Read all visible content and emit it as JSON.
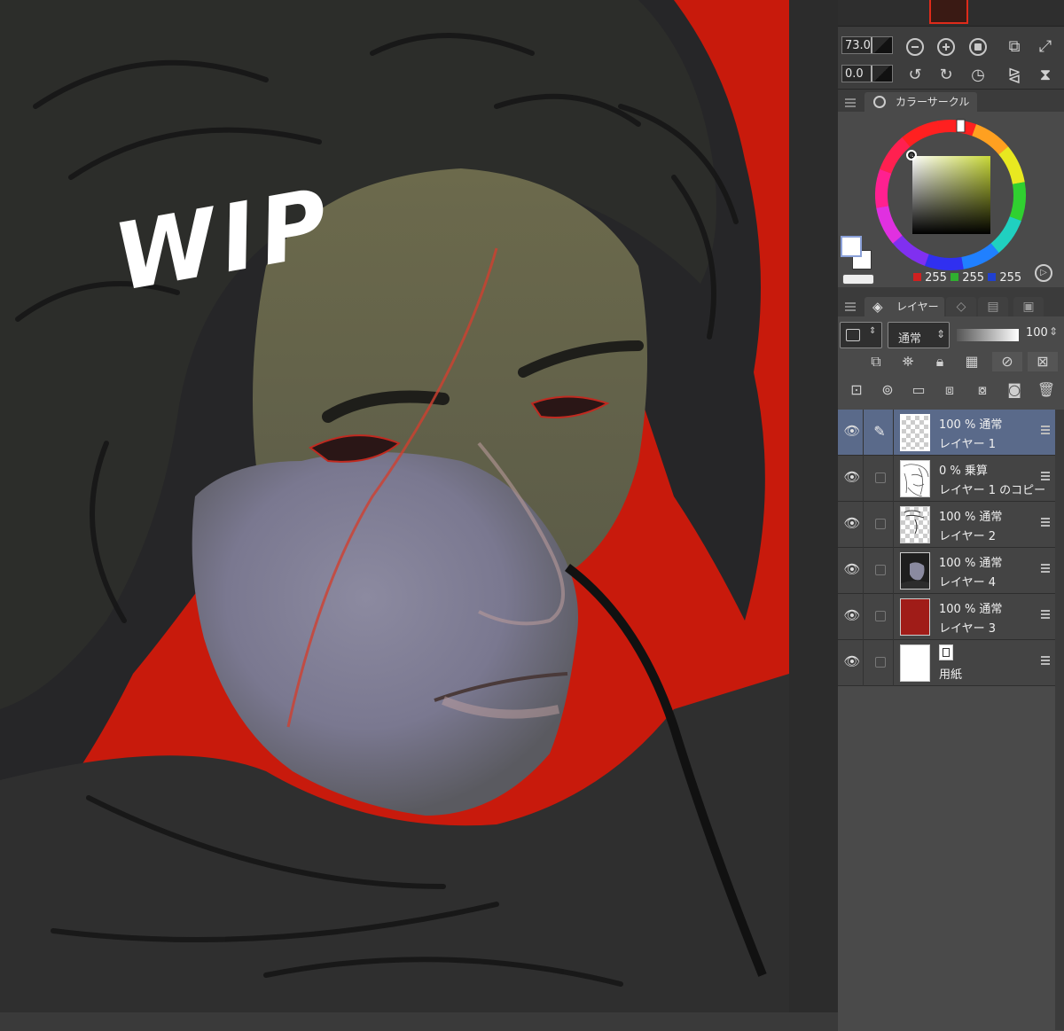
{
  "canvas": {
    "overlay_text": "WIP",
    "background_color": "#c81a0c"
  },
  "navigator": {
    "zoom_value": "73.0",
    "rotate_value": "0.0",
    "zoom_icons": [
      "zoom-out-icon",
      "zoom-in-icon",
      "fit-icon",
      "actual-size-icon",
      "fit-window-icon"
    ],
    "rotate_icons": [
      "rotate-left-icon",
      "rotate-right-icon",
      "reset-rotation-icon",
      "flip-horizontal-icon",
      "flip-vertical-icon"
    ]
  },
  "color_panel": {
    "tab_label": "カラーサークル",
    "rgb": {
      "r": "255",
      "g": "255",
      "b": "255"
    },
    "hue_color": "#c8d838"
  },
  "layer_panel": {
    "tab_label": "レイヤー",
    "blend_mode": "通常",
    "opacity": "100",
    "layers": [
      {
        "mode": "100 % 通常",
        "name": "レイヤー 1",
        "active": true,
        "thumb": "transparent"
      },
      {
        "mode": "0 % 乗算",
        "name": "レイヤー 1 のコピー",
        "active": false,
        "thumb": "sketch"
      },
      {
        "mode": "100 % 通常",
        "name": "レイヤー 2",
        "active": false,
        "thumb": "sketch-partial"
      },
      {
        "mode": "100 % 通常",
        "name": "レイヤー 4",
        "active": false,
        "thumb": "portrait"
      },
      {
        "mode": "100 % 通常",
        "name": "レイヤー 3",
        "active": false,
        "thumb": "red-fill"
      },
      {
        "mode": "",
        "name": "用紙",
        "active": false,
        "thumb": "paper"
      }
    ]
  }
}
